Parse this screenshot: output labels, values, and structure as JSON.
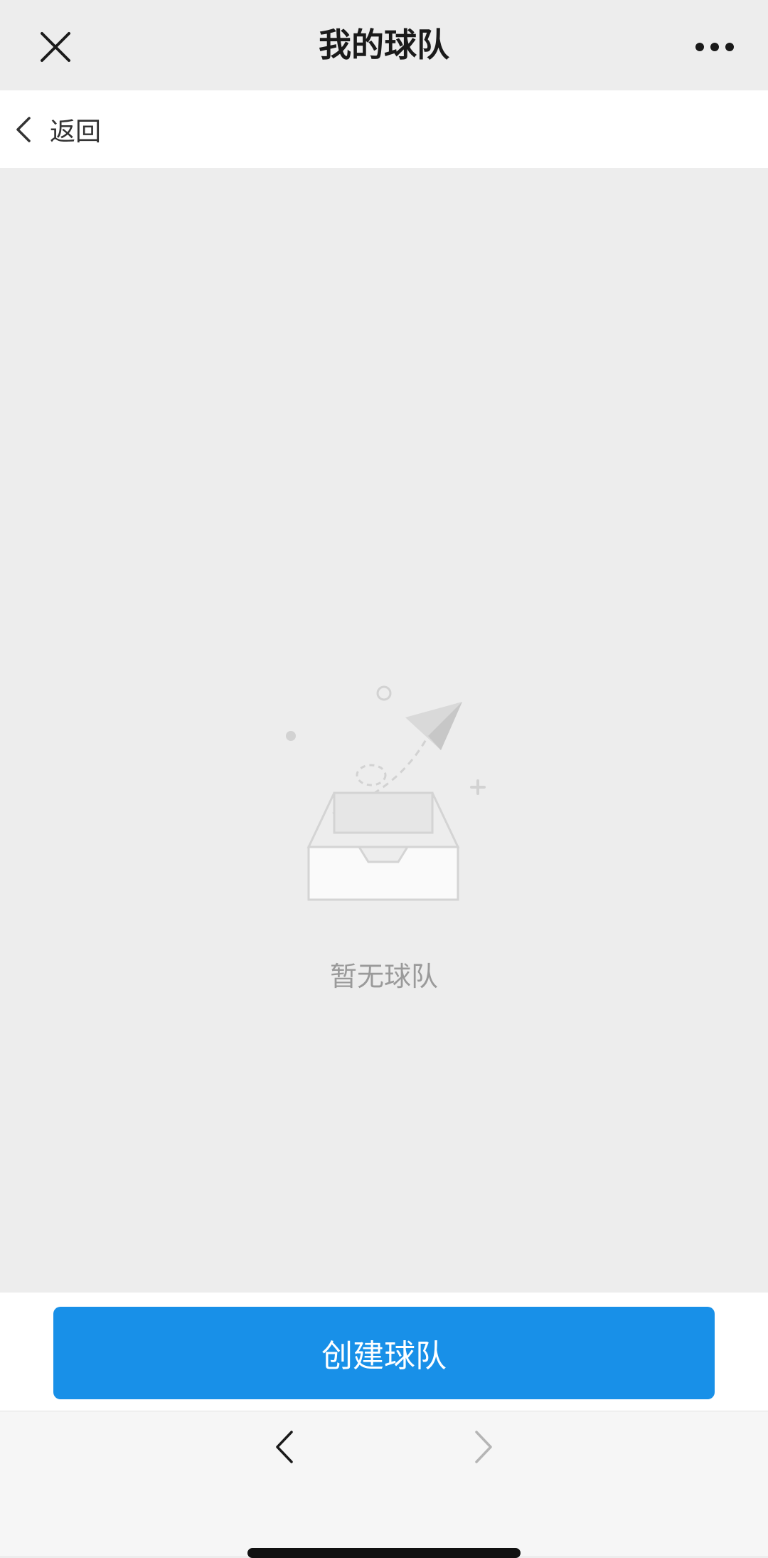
{
  "titlebar": {
    "title": "我的球队",
    "close_icon": "close-icon",
    "more_icon": "more-horizontal-icon"
  },
  "backbar": {
    "label": "返回",
    "icon": "chevron-left-icon"
  },
  "empty_state": {
    "illustration": "empty-inbox-paper-plane-illustration",
    "message": "暂无球队"
  },
  "actions": {
    "create_label": "创建球队"
  },
  "navbar": {
    "back_icon": "chevron-left-icon",
    "forward_icon": "chevron-right-icon"
  },
  "colors": {
    "page_bg": "#ededed",
    "primary": "#1890e8",
    "title_text": "#1a1a1a",
    "muted_text": "#9a9a9a"
  }
}
